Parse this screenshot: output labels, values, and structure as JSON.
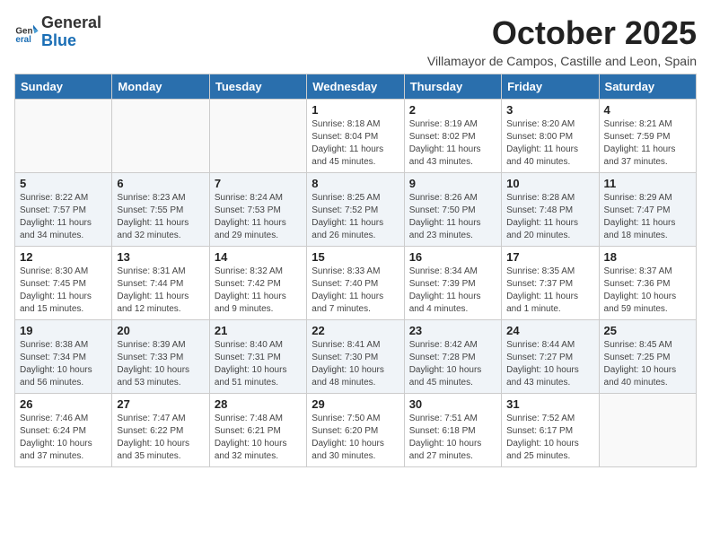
{
  "header": {
    "logo_general": "General",
    "logo_blue": "Blue",
    "month_title": "October 2025",
    "subtitle": "Villamayor de Campos, Castille and Leon, Spain"
  },
  "weekdays": [
    "Sunday",
    "Monday",
    "Tuesday",
    "Wednesday",
    "Thursday",
    "Friday",
    "Saturday"
  ],
  "weeks": [
    [
      {
        "day": "",
        "info": ""
      },
      {
        "day": "",
        "info": ""
      },
      {
        "day": "",
        "info": ""
      },
      {
        "day": "1",
        "info": "Sunrise: 8:18 AM\nSunset: 8:04 PM\nDaylight: 11 hours and 45 minutes."
      },
      {
        "day": "2",
        "info": "Sunrise: 8:19 AM\nSunset: 8:02 PM\nDaylight: 11 hours and 43 minutes."
      },
      {
        "day": "3",
        "info": "Sunrise: 8:20 AM\nSunset: 8:00 PM\nDaylight: 11 hours and 40 minutes."
      },
      {
        "day": "4",
        "info": "Sunrise: 8:21 AM\nSunset: 7:59 PM\nDaylight: 11 hours and 37 minutes."
      }
    ],
    [
      {
        "day": "5",
        "info": "Sunrise: 8:22 AM\nSunset: 7:57 PM\nDaylight: 11 hours and 34 minutes."
      },
      {
        "day": "6",
        "info": "Sunrise: 8:23 AM\nSunset: 7:55 PM\nDaylight: 11 hours and 32 minutes."
      },
      {
        "day": "7",
        "info": "Sunrise: 8:24 AM\nSunset: 7:53 PM\nDaylight: 11 hours and 29 minutes."
      },
      {
        "day": "8",
        "info": "Sunrise: 8:25 AM\nSunset: 7:52 PM\nDaylight: 11 hours and 26 minutes."
      },
      {
        "day": "9",
        "info": "Sunrise: 8:26 AM\nSunset: 7:50 PM\nDaylight: 11 hours and 23 minutes."
      },
      {
        "day": "10",
        "info": "Sunrise: 8:28 AM\nSunset: 7:48 PM\nDaylight: 11 hours and 20 minutes."
      },
      {
        "day": "11",
        "info": "Sunrise: 8:29 AM\nSunset: 7:47 PM\nDaylight: 11 hours and 18 minutes."
      }
    ],
    [
      {
        "day": "12",
        "info": "Sunrise: 8:30 AM\nSunset: 7:45 PM\nDaylight: 11 hours and 15 minutes."
      },
      {
        "day": "13",
        "info": "Sunrise: 8:31 AM\nSunset: 7:44 PM\nDaylight: 11 hours and 12 minutes."
      },
      {
        "day": "14",
        "info": "Sunrise: 8:32 AM\nSunset: 7:42 PM\nDaylight: 11 hours and 9 minutes."
      },
      {
        "day": "15",
        "info": "Sunrise: 8:33 AM\nSunset: 7:40 PM\nDaylight: 11 hours and 7 minutes."
      },
      {
        "day": "16",
        "info": "Sunrise: 8:34 AM\nSunset: 7:39 PM\nDaylight: 11 hours and 4 minutes."
      },
      {
        "day": "17",
        "info": "Sunrise: 8:35 AM\nSunset: 7:37 PM\nDaylight: 11 hours and 1 minute."
      },
      {
        "day": "18",
        "info": "Sunrise: 8:37 AM\nSunset: 7:36 PM\nDaylight: 10 hours and 59 minutes."
      }
    ],
    [
      {
        "day": "19",
        "info": "Sunrise: 8:38 AM\nSunset: 7:34 PM\nDaylight: 10 hours and 56 minutes."
      },
      {
        "day": "20",
        "info": "Sunrise: 8:39 AM\nSunset: 7:33 PM\nDaylight: 10 hours and 53 minutes."
      },
      {
        "day": "21",
        "info": "Sunrise: 8:40 AM\nSunset: 7:31 PM\nDaylight: 10 hours and 51 minutes."
      },
      {
        "day": "22",
        "info": "Sunrise: 8:41 AM\nSunset: 7:30 PM\nDaylight: 10 hours and 48 minutes."
      },
      {
        "day": "23",
        "info": "Sunrise: 8:42 AM\nSunset: 7:28 PM\nDaylight: 10 hours and 45 minutes."
      },
      {
        "day": "24",
        "info": "Sunrise: 8:44 AM\nSunset: 7:27 PM\nDaylight: 10 hours and 43 minutes."
      },
      {
        "day": "25",
        "info": "Sunrise: 8:45 AM\nSunset: 7:25 PM\nDaylight: 10 hours and 40 minutes."
      }
    ],
    [
      {
        "day": "26",
        "info": "Sunrise: 7:46 AM\nSunset: 6:24 PM\nDaylight: 10 hours and 37 minutes."
      },
      {
        "day": "27",
        "info": "Sunrise: 7:47 AM\nSunset: 6:22 PM\nDaylight: 10 hours and 35 minutes."
      },
      {
        "day": "28",
        "info": "Sunrise: 7:48 AM\nSunset: 6:21 PM\nDaylight: 10 hours and 32 minutes."
      },
      {
        "day": "29",
        "info": "Sunrise: 7:50 AM\nSunset: 6:20 PM\nDaylight: 10 hours and 30 minutes."
      },
      {
        "day": "30",
        "info": "Sunrise: 7:51 AM\nSunset: 6:18 PM\nDaylight: 10 hours and 27 minutes."
      },
      {
        "day": "31",
        "info": "Sunrise: 7:52 AM\nSunset: 6:17 PM\nDaylight: 10 hours and 25 minutes."
      },
      {
        "day": "",
        "info": ""
      }
    ]
  ]
}
